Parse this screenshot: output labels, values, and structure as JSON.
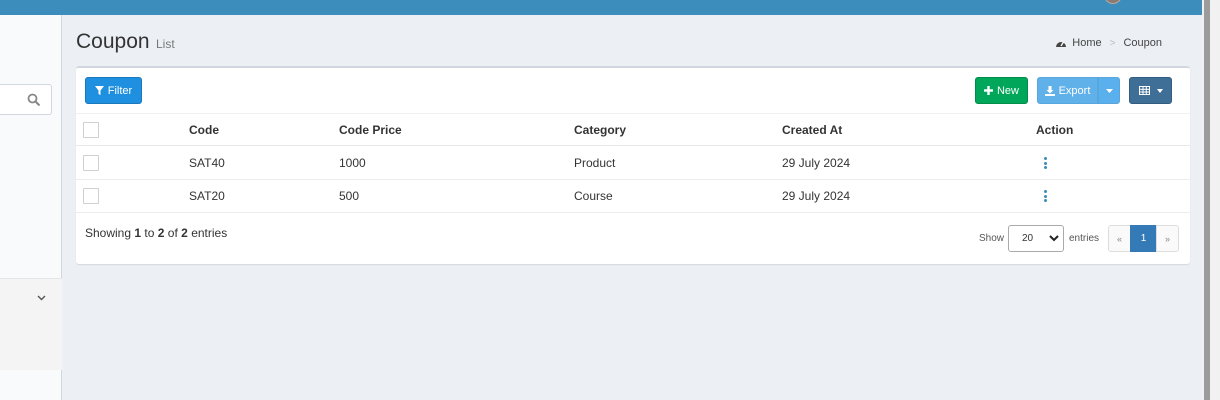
{
  "header": {
    "title": "Coupon",
    "subtitle": "List",
    "breadcrumb": [
      "Home",
      "Coupon"
    ],
    "breadcrumb_separator": ">"
  },
  "toolbar": {
    "filter_label": "Filter",
    "new_label": "New",
    "export_label": "Export"
  },
  "grid": {
    "columns": [
      "Code",
      "Code Price",
      "Category",
      "Created At",
      "Action"
    ],
    "rows": [
      {
        "code": "SAT40",
        "price": "1000",
        "category": "Product",
        "created_at": "29 July 2024"
      },
      {
        "code": "SAT20",
        "price": "500",
        "category": "Course",
        "created_at": "29 July 2024"
      }
    ]
  },
  "footer": {
    "showing_prefix": "Showing",
    "from": "1",
    "to_word": "to",
    "to": "2",
    "of_word": "of",
    "total": "2",
    "entries_word": "entries",
    "per_page_label": "Show",
    "per_page_value": "20",
    "per_page_suffix": "entries",
    "pager": {
      "prev": "«",
      "current": "1",
      "next": "»"
    }
  },
  "colors": {
    "topbar": "#3c8dbc",
    "filter_button": "#1f8fe0",
    "new_button": "#00a65a",
    "export_button": "#60b0ea",
    "columns_button": "#3f6f97",
    "active_page": "#337ab7"
  },
  "icons": {
    "sidebar_search": "search-icon",
    "sidebar_expand": "chevron-down-icon",
    "breadcrumb_home": "dashboard-icon",
    "filter": "filter-icon",
    "new": "plus-icon",
    "export": "download-icon",
    "columns": "table-icon",
    "row_action": "kebab-menu-icon"
  }
}
